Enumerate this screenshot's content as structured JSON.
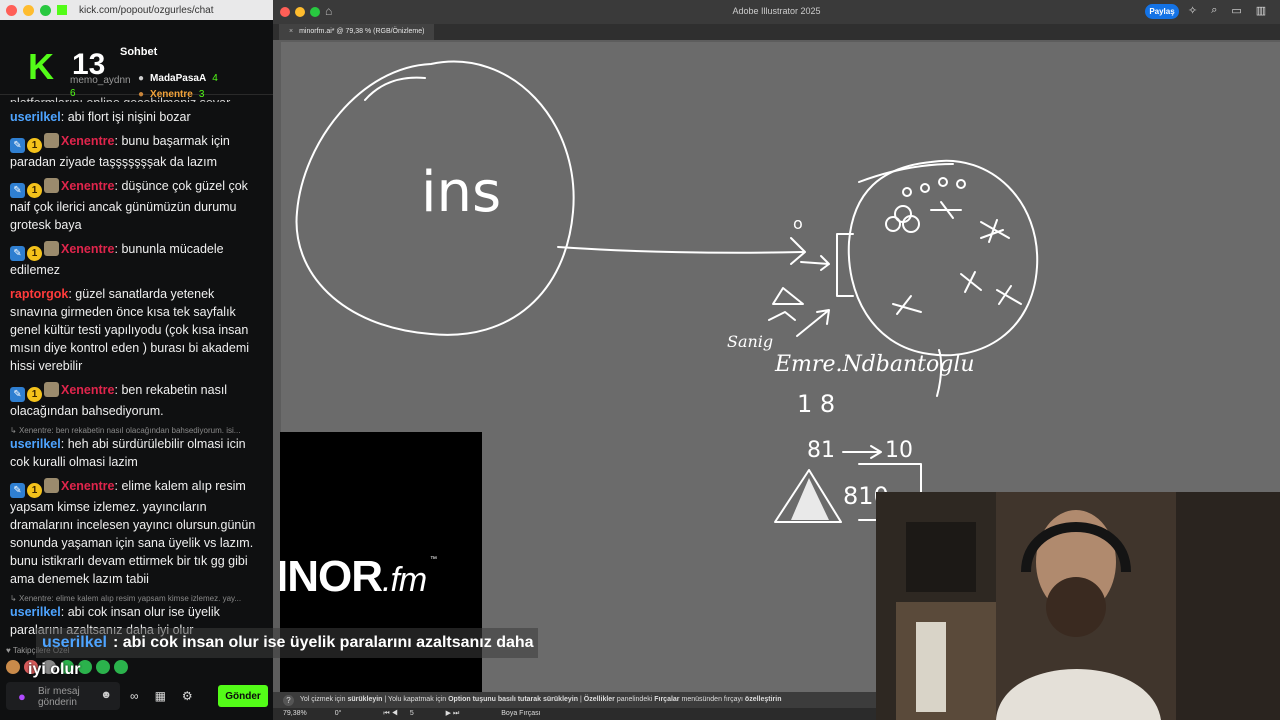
{
  "chat_window": {
    "url": "kick.com/popout/ozgurles/chat",
    "title": "Sohbet",
    "viewer_count": "13",
    "top_gifters": [
      {
        "name": "MadaPasaA",
        "count": "4"
      },
      {
        "name": "Xenentre",
        "count": "3"
      }
    ],
    "hidden_gifter_name": "memo_aydnn",
    "hidden_gifter_count": "6",
    "clipped_line": "platformlarını online geçebilmeniz sevar",
    "messages": [
      {
        "user": "userilkel",
        "text": "abi flort işi nişini bozar"
      },
      {
        "user": "Xenentre",
        "text": "bunu başarmak için paradan ziyade taşşşşşşşak da lazım"
      },
      {
        "user": "Xenentre",
        "text": "düşünce çok güzel çok naif çok ilerici ancak günümüzün durumu grotesk baya"
      },
      {
        "user": "Xenentre",
        "text": "bununla mücadele edilemez"
      },
      {
        "user": "raptorgok",
        "text": "güzel sanatlarda yetenek sınavına girmeden önce kısa tek sayfalık genel kültür testi yapılıyodu (çok kısa insan mısın diye kontrol eden ) burası bi akademi hissi verebilir"
      },
      {
        "user": "Xenentre",
        "text": "ben rekabetin nasıl olacağından bahsediyorum."
      },
      {
        "reply": "Xenentre: ben rekabetin nasıl olacağından bahsediyorum. isi...",
        "user": "userilkel",
        "text": "heh abi sürdürülebilir olmasi icin cok kuralli olmasi lazim"
      },
      {
        "user": "Xenentre",
        "text": "elime kalem alıp resim yapsam kimse izlemez. yayıncıların dramalarını incelesen yayıncı olursun.günün sonunda yaşaman için sana üyelik vs lazım. bunu istikrarlı devam ettirmek bir tık gg gibi ama denemek lazım tabii"
      },
      {
        "reply": "Xenentre: elime kalem alıp resim yapsam kimse izlemez. yay...",
        "user": "userilkel",
        "text": "abi cok insan olur ise üyelik paralarını azaltsanız daha iyi olur"
      }
    ],
    "follow_label": "Takipçilere Özel",
    "input_placeholder": "Bir mesaj gönderin",
    "send_label": "Gönder",
    "colors": {
      "accent": "#53fc18",
      "mod_user": "#e0254c",
      "user": "#4ea4ff"
    }
  },
  "illustrator": {
    "app_title": "Adobe Illustrator 2025",
    "share_label": "Paylaş",
    "tab_label": "minorfm.ai* @ 79,38 % (RGB/Önizleme)",
    "status_text": {
      "p1": "Yol çizmek için",
      "b1": "sürükleyin",
      "p2": "| Yolu kapatmak için",
      "b2": "Option tuşunu basılı tutarak sürükleyin",
      "p3": "|",
      "b3": "Özellikler",
      "p4": "panelindeki",
      "b4": "Fırçalar",
      "p5": "menüsünden fırçayı",
      "b5": "özelleştirin"
    },
    "zoom": "79,38%",
    "angle": "0°",
    "artboard": "5",
    "tool_name": "Boya Fırçası",
    "drawing_texts": {
      "ins": "ins",
      "signature": "Emre.Ndbantoglu",
      "sign_label": "Sanig",
      "num_18": "1 8",
      "num_81": "81",
      "num_10": "10",
      "num_810": "810",
      "num_0": "o"
    }
  },
  "overlays": {
    "minor_logo_main": "INOR",
    "minor_logo_suffix": ".fm",
    "minor_logo_tm": "™",
    "caption_user": "userilkel",
    "caption_text": ": abi cok insan olur ise üyelik paralarını azaltsanız daha",
    "caption_line2": "iyi olur"
  }
}
